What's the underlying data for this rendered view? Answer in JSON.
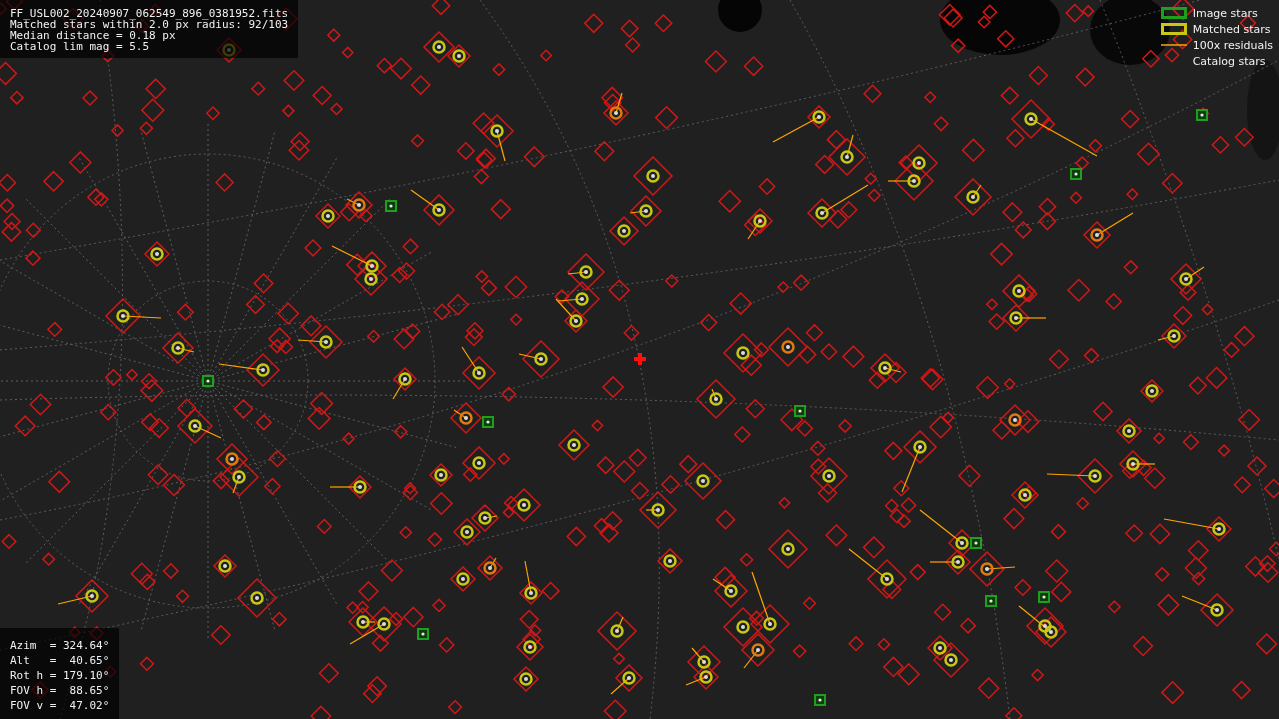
{
  "info": {
    "lines": [
      "FF_USL002_20240907_062549_896_0381952.fits",
      "Matched stars within 2.0 px radius: 92/103",
      "Median distance = 0.18 px",
      "Catalog lim mag = 5.5"
    ]
  },
  "legend": [
    {
      "kind": "image",
      "label": "Image stars"
    },
    {
      "kind": "matched",
      "label": "Matched stars"
    },
    {
      "kind": "residual",
      "label": "100x residuals"
    },
    {
      "kind": "catalog",
      "label": "Catalog stars"
    }
  ],
  "pointing": {
    "lines": [
      "Azim  = 324.64°",
      "Alt   =  40.65°",
      "Rot h = 179.10°",
      "FOV h =  88.65°",
      "FOV v =  47.02°"
    ]
  }
}
